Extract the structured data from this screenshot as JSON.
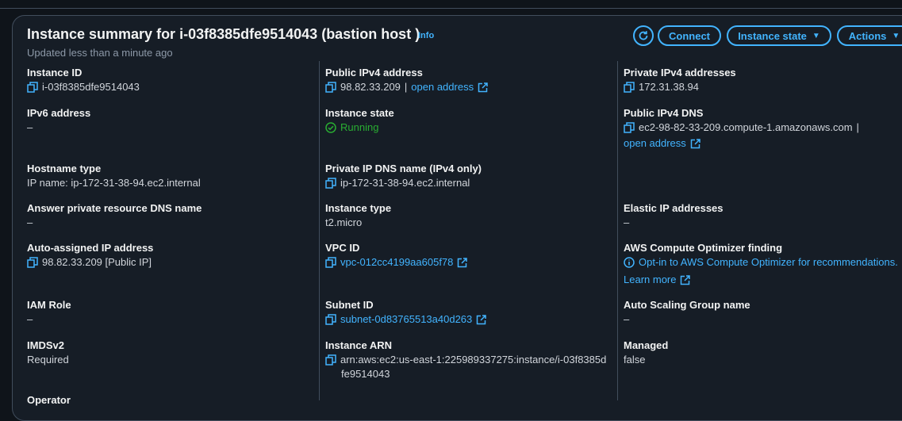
{
  "header": {
    "title": "Instance summary for i-03f8385dfe9514043 (bastion host )",
    "info": "Info",
    "subtitle": "Updated less than a minute ago",
    "connect": "Connect",
    "instance_state": "Instance state",
    "actions": "Actions"
  },
  "col1": {
    "instance_id_label": "Instance ID",
    "instance_id": "i-03f8385dfe9514043",
    "ipv6_label": "IPv6 address",
    "ipv6": "–",
    "hostname_type_label": "Hostname type",
    "hostname_type": "IP name: ip-172-31-38-94.ec2.internal",
    "answer_dns_label": "Answer private resource DNS name",
    "answer_dns": "–",
    "auto_ip_label": "Auto-assigned IP address",
    "auto_ip": "98.82.33.209 [Public IP]",
    "iam_role_label": "IAM Role",
    "iam_role": "–",
    "imdsv2_label": "IMDSv2",
    "imdsv2": "Required",
    "operator_label": "Operator"
  },
  "col2": {
    "public_ipv4_label": "Public IPv4 address",
    "public_ipv4": "98.82.33.209",
    "sep": "|",
    "open_address": "open address",
    "instance_state_label": "Instance state",
    "instance_state": "Running",
    "private_dns_label": "Private IP DNS name (IPv4 only)",
    "private_dns": "ip-172-31-38-94.ec2.internal",
    "instance_type_label": "Instance type",
    "instance_type": "t2.micro",
    "vpc_label": "VPC ID",
    "vpc": "vpc-012cc4199aa605f78",
    "subnet_label": "Subnet ID",
    "subnet": "subnet-0d83765513a40d263",
    "arn_label": "Instance ARN",
    "arn_line1": "arn:aws:ec2:us-east-1:225989337275:instance/i-03f8385d",
    "arn_line2": "fe9514043"
  },
  "col3": {
    "private_ipv4_label": "Private IPv4 addresses",
    "private_ipv4": "172.31.38.94",
    "public_dns_label": "Public IPv4 DNS",
    "public_dns": "ec2-98-82-33-209.compute-1.amazonaws.com",
    "sep": "|",
    "open_address": "open address",
    "elastic_ip_label": "Elastic IP addresses",
    "elastic_ip": "–",
    "optimizer_label": "AWS Compute Optimizer finding",
    "optimizer": "Opt-in to AWS Compute Optimizer for recommendations.",
    "learn_more": "Learn more",
    "asg_label": "Auto Scaling Group name",
    "asg": "–",
    "managed_label": "Managed",
    "managed": "false"
  },
  "icons": {
    "copy": "copy-icon",
    "external": "external-link-icon",
    "refresh": "refresh-icon",
    "status_ok": "status-success-icon",
    "info": "info-circle-icon",
    "caret": "caret-down-icon"
  },
  "colors": {
    "background": "#0f141a",
    "panel": "#161d26",
    "link": "#42b4ff",
    "success": "#29ad32",
    "border": "#414d5c"
  }
}
